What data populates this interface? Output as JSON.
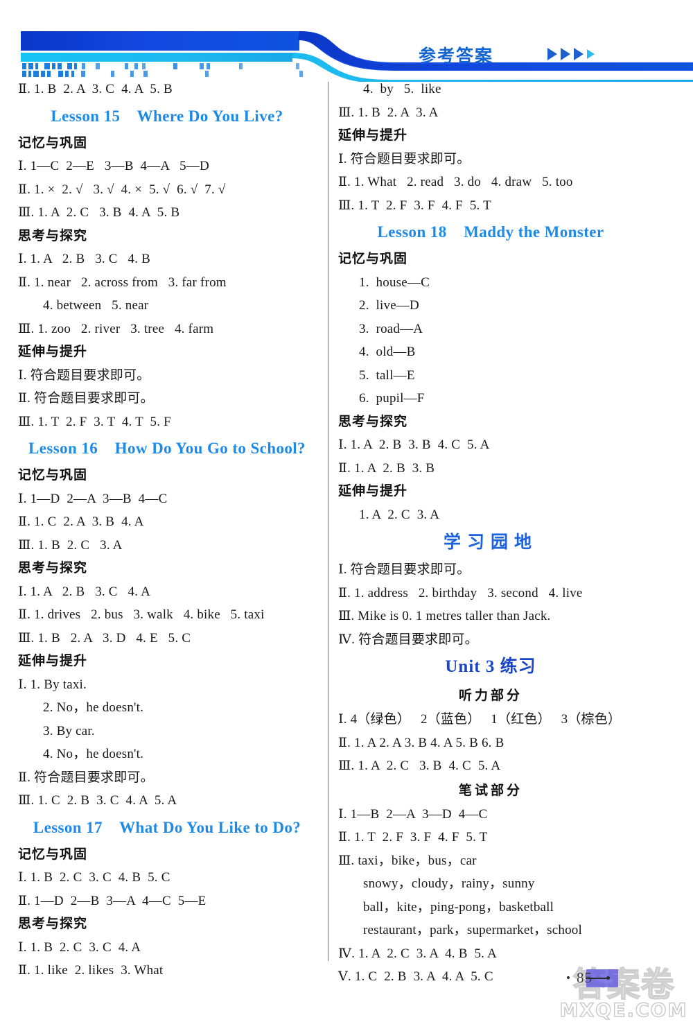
{
  "header": {
    "title": "参考答案",
    "arrow_icon": "triangle-right-icon",
    "band_color_dark": "#0b3fd0",
    "band_color_light": "#16c0f0",
    "title_color": "#1464d2"
  },
  "left_column": [
    {
      "type": "line",
      "text": "Ⅱ. 1. B  2. A  3. C  4. A  5. B"
    },
    {
      "type": "lesson",
      "text": "Lesson 15    Where Do You Live?"
    },
    {
      "type": "cn_head",
      "text": "记忆与巩固"
    },
    {
      "type": "line",
      "text": "Ⅰ. 1—C  2—E   3—B  4—A   5—D"
    },
    {
      "type": "line",
      "text": "Ⅱ. 1. ×  2. √   3. √  4. ×  5. √  6. √  7. √"
    },
    {
      "type": "line",
      "text": "Ⅲ. 1. A  2. C   3. B  4. A  5. B"
    },
    {
      "type": "cn_head",
      "text": "思考与探究"
    },
    {
      "type": "line",
      "text": "Ⅰ. 1. A   2. B   3. C   4. B"
    },
    {
      "type": "line",
      "text": "Ⅱ. 1. near   2. across from   3. far from"
    },
    {
      "type": "line_i1",
      "text": "4. between   5. near"
    },
    {
      "type": "line",
      "text": "Ⅲ. 1. zoo   2. river   3. tree   4. farm"
    },
    {
      "type": "cn_head",
      "text": "延伸与提升"
    },
    {
      "type": "line",
      "text": "Ⅰ. 符合题目要求即可。"
    },
    {
      "type": "line",
      "text": "Ⅱ. 符合题目要求即可。"
    },
    {
      "type": "line",
      "text": "Ⅲ. 1. T  2. F  3. T  4. T  5. F"
    },
    {
      "type": "lesson",
      "text": "Lesson 16    How Do You Go to School?"
    },
    {
      "type": "cn_head",
      "text": "记忆与巩固"
    },
    {
      "type": "line",
      "text": "Ⅰ. 1—D  2—A  3—B  4—C"
    },
    {
      "type": "line",
      "text": "Ⅱ. 1. C  2. A  3. B  4. A"
    },
    {
      "type": "line",
      "text": "Ⅲ. 1. B  2. C   3. A"
    },
    {
      "type": "cn_head",
      "text": "思考与探究"
    },
    {
      "type": "line",
      "text": "Ⅰ. 1. A   2. B   3. C   4. A"
    },
    {
      "type": "line",
      "text": "Ⅱ. 1. drives   2. bus   3. walk   4. bike   5. taxi"
    },
    {
      "type": "line",
      "text": "Ⅲ. 1. B   2. A   3. D   4. E   5. C"
    },
    {
      "type": "cn_head",
      "text": "延伸与提升"
    },
    {
      "type": "line",
      "text": "Ⅰ. 1. By taxi."
    },
    {
      "type": "line_i1",
      "text": "2. No，he doesn't."
    },
    {
      "type": "line_i1",
      "text": "3. By car."
    },
    {
      "type": "line_i1",
      "text": "4. No，he doesn't."
    },
    {
      "type": "line",
      "text": "Ⅱ. 符合题目要求即可。"
    },
    {
      "type": "line",
      "text": "Ⅲ. 1. C  2. B  3. C  4. A  5. A"
    },
    {
      "type": "lesson",
      "text": "Lesson 17    What Do You Like to Do?"
    },
    {
      "type": "cn_head",
      "text": "记忆与巩固"
    },
    {
      "type": "line",
      "text": "Ⅰ. 1. B  2. C  3. C  4. B  5. C"
    },
    {
      "type": "line",
      "text": "Ⅱ. 1—D  2—B  3—A  4—C  5—E"
    },
    {
      "type": "cn_head",
      "text": "思考与探究"
    },
    {
      "type": "line",
      "text": "Ⅰ. 1. B  2. C  3. C  4. A"
    },
    {
      "type": "line",
      "text": "Ⅱ. 1. like  2. likes  3. What"
    }
  ],
  "right_column": [
    {
      "type": "line_i1",
      "text": "4.  by   5.  like"
    },
    {
      "type": "line",
      "text": "Ⅲ. 1. B  2. A  3. A"
    },
    {
      "type": "cn_head",
      "text": "延伸与提升"
    },
    {
      "type": "line",
      "text": "Ⅰ. 符合题目要求即可。"
    },
    {
      "type": "line",
      "text": "Ⅱ. 1. What   2. read   3. do   4. draw   5. too"
    },
    {
      "type": "line",
      "text": "Ⅲ. 1. T  2. F  3. F  4. F  5. T"
    },
    {
      "type": "lesson",
      "text": "Lesson 18    Maddy the Monster"
    },
    {
      "type": "cn_head",
      "text": "记忆与巩固"
    },
    {
      "type": "line_i2",
      "text": "1.  house—C"
    },
    {
      "type": "line_i2",
      "text": "2.  live—D"
    },
    {
      "type": "line_i2",
      "text": "3.  road—A"
    },
    {
      "type": "line_i2",
      "text": "4.  old—B"
    },
    {
      "type": "line_i2",
      "text": "5.  tall—E"
    },
    {
      "type": "line_i2",
      "text": "6.  pupil—F"
    },
    {
      "type": "cn_head",
      "text": "思考与探究"
    },
    {
      "type": "line",
      "text": "Ⅰ. 1. A  2. B  3. B  4. C  5. A"
    },
    {
      "type": "line",
      "text": "Ⅱ. 1. A  2. B  3. B"
    },
    {
      "type": "cn_head",
      "text": "延伸与提升"
    },
    {
      "type": "line_i2",
      "text": "1. A  2. C  3. A"
    },
    {
      "type": "section_cn",
      "text": "学习园地"
    },
    {
      "type": "line",
      "text": "Ⅰ. 符合题目要求即可。"
    },
    {
      "type": "line",
      "text": "Ⅱ. 1. address   2. birthday   3. second   4. live"
    },
    {
      "type": "line",
      "text": "Ⅲ. Mike is 0. 1 metres taller than Jack."
    },
    {
      "type": "line",
      "text": "Ⅳ. 符合题目要求即可。"
    },
    {
      "type": "unit",
      "text": "Unit 3 练习"
    },
    {
      "type": "part",
      "text": "听力部分"
    },
    {
      "type": "line",
      "text": "Ⅰ. 4（绿色）   2（蓝色）   1（红色）   3（棕色）"
    },
    {
      "type": "line",
      "text": "Ⅱ. 1. A 2. A 3. B 4. A 5. B 6. B"
    },
    {
      "type": "line",
      "text": "Ⅲ. 1. A  2. C   3. B  4. C  5. A"
    },
    {
      "type": "part",
      "text": "笔试部分"
    },
    {
      "type": "line",
      "text": "Ⅰ. 1—B  2—A  3—D  4—C"
    },
    {
      "type": "line",
      "text": "Ⅱ. 1. T  2. F  3. F  4. F  5. T"
    },
    {
      "type": "line",
      "text": "Ⅲ. taxi，bike，bus，car"
    },
    {
      "type": "line_i1",
      "text": "snowy，cloudy，rainy，sunny"
    },
    {
      "type": "line_i1",
      "text": "ball，kite，ping-pong，basketball"
    },
    {
      "type": "line_i1",
      "text": "restaurant，park，supermarket，school"
    },
    {
      "type": "line",
      "text": "Ⅳ. 1. A  2. C  3. A  4. B  5. A"
    },
    {
      "type": "line",
      "text": "Ⅴ. 1. C  2. B  3. A  4. A  5. C"
    }
  ],
  "footer": {
    "page_number": "85",
    "watermark_text": "MXQE.COM",
    "watermark_cn": "答案卷"
  }
}
